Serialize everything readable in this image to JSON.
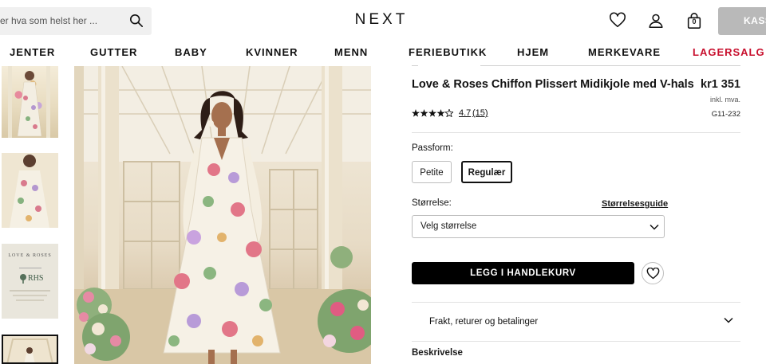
{
  "header": {
    "search_placeholder": "er hva som helst her ...",
    "logo": "NEXT",
    "checkout_label": "KASSE",
    "bag_count": "0",
    "icons": [
      "search-icon",
      "heart-icon",
      "user-icon",
      "bag-icon"
    ]
  },
  "nav": {
    "items": [
      {
        "label": "JENTER"
      },
      {
        "label": "GUTTER"
      },
      {
        "label": "BABY"
      },
      {
        "label": "KVINNER"
      },
      {
        "label": "MENN"
      },
      {
        "label": "FERIEBUTIKK"
      },
      {
        "label": "HJEM"
      },
      {
        "label": "MERKEVARE"
      },
      {
        "label": "LAGERSALG"
      }
    ],
    "sale_color": "#c8102e"
  },
  "gallery": {
    "brand_card": {
      "brand_line1": "LOVE",
      "brand_line2": "ROSES",
      "partner": "RHS"
    }
  },
  "product": {
    "title": "Love & Roses Chiffon Plissert Midikjole med V-hals",
    "price": "kr1 351",
    "vat_note": "inkl. mva.",
    "sku": "G11-232",
    "rating": "4.7",
    "rating_value": 4.7,
    "reviews": "(15)",
    "fit_label": "Passform:",
    "fit_options": [
      {
        "label": "Petite",
        "selected": false
      },
      {
        "label": "Regulær",
        "selected": true
      }
    ],
    "size_label": "Størrelse:",
    "size_guide": "Størrelsesguide",
    "size_select": "Velg størrelse",
    "add_to_bag": "LEGG I HANDLEKURV",
    "shipping": "Frakt, returer og betalinger",
    "description": "Beskrivelse"
  },
  "colors": {
    "checkout_bg": "#b9b9b9",
    "primary_button": "#000000"
  }
}
